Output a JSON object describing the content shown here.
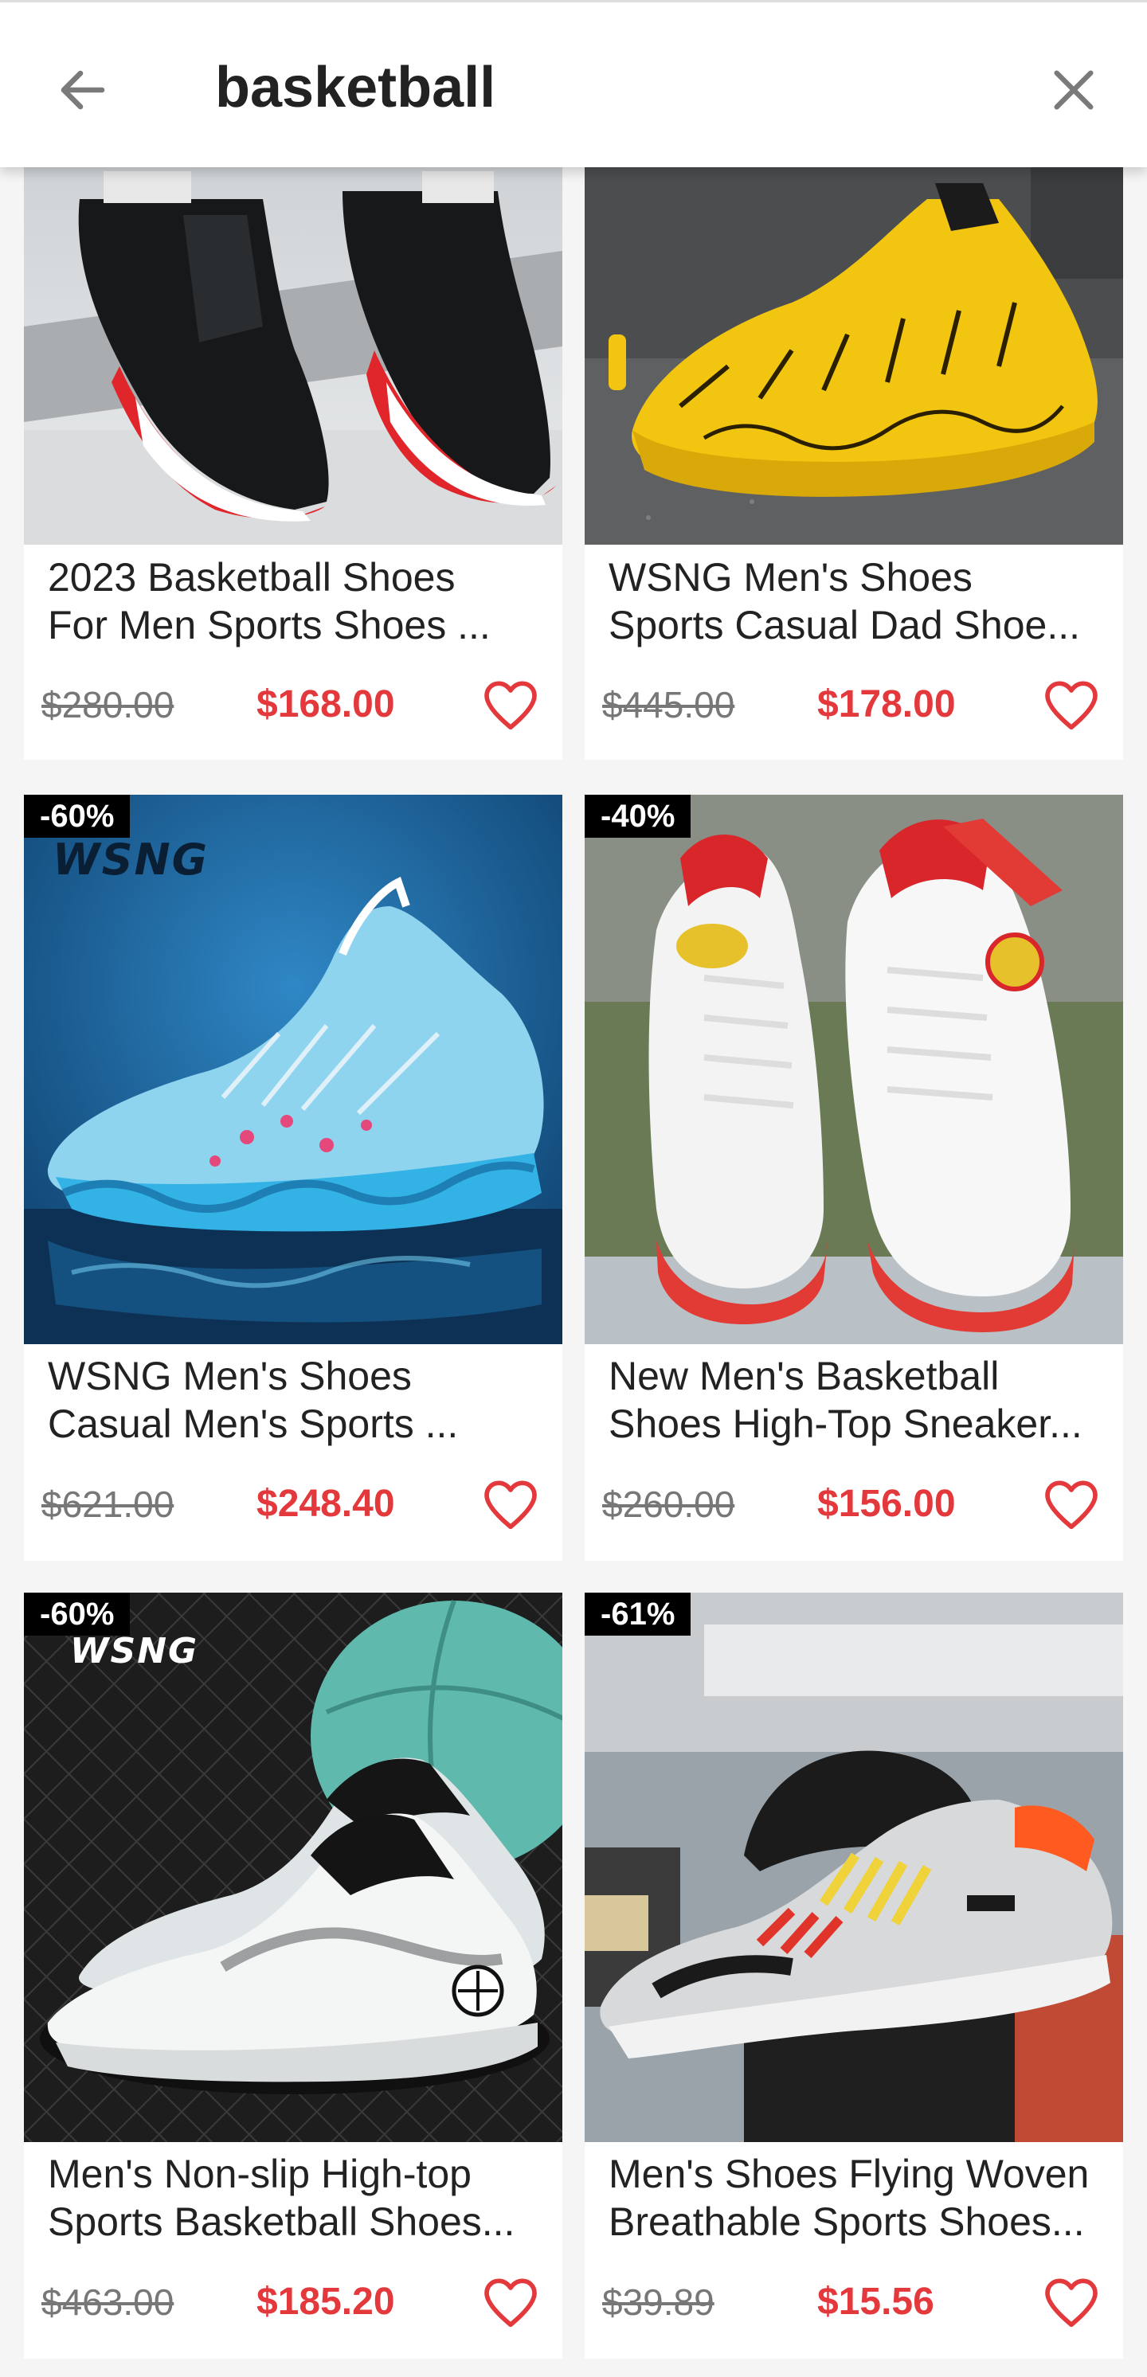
{
  "header": {
    "search_query": "basketball",
    "back_icon": "arrow-left-icon",
    "clear_icon": "close-icon"
  },
  "colors": {
    "accent_price": "#e3393c",
    "badge_bg": "#000000",
    "background": "#f5f5f5"
  },
  "products": [
    {
      "title_line1": "2023 Basketball Shoes",
      "title_line2": "For Men Sports Shoes ...",
      "original_price": "$280.00",
      "sale_price": "$168.00",
      "discount": "",
      "brand_mark": ""
    },
    {
      "title_line1": "WSNG Men's Shoes",
      "title_line2": "Sports Casual Dad Shoe...",
      "original_price": "$445.00",
      "sale_price": "$178.00",
      "discount": "",
      "brand_mark": ""
    },
    {
      "title_line1": "WSNG Men's Shoes",
      "title_line2": "Casual Men's Sports ...",
      "original_price": "$621.00",
      "sale_price": "$248.40",
      "discount": "-60%",
      "brand_mark": "WSNG"
    },
    {
      "title_line1": "New Men's Basketball",
      "title_line2": "Shoes High-Top Sneaker...",
      "original_price": "$260.00",
      "sale_price": "$156.00",
      "discount": "-40%",
      "brand_mark": ""
    },
    {
      "title_line1": "Men's Non-slip High-top",
      "title_line2": "Sports Basketball Shoes...",
      "original_price": "$463.00",
      "sale_price": "$185.20",
      "discount": "-60%",
      "brand_mark": "WSNG"
    },
    {
      "title_line1": "Men's Shoes Flying Woven",
      "title_line2": "Breathable Sports Shoes...",
      "original_price": "$39.89",
      "sale_price": "$15.56",
      "discount": "-61%",
      "brand_mark": ""
    }
  ]
}
